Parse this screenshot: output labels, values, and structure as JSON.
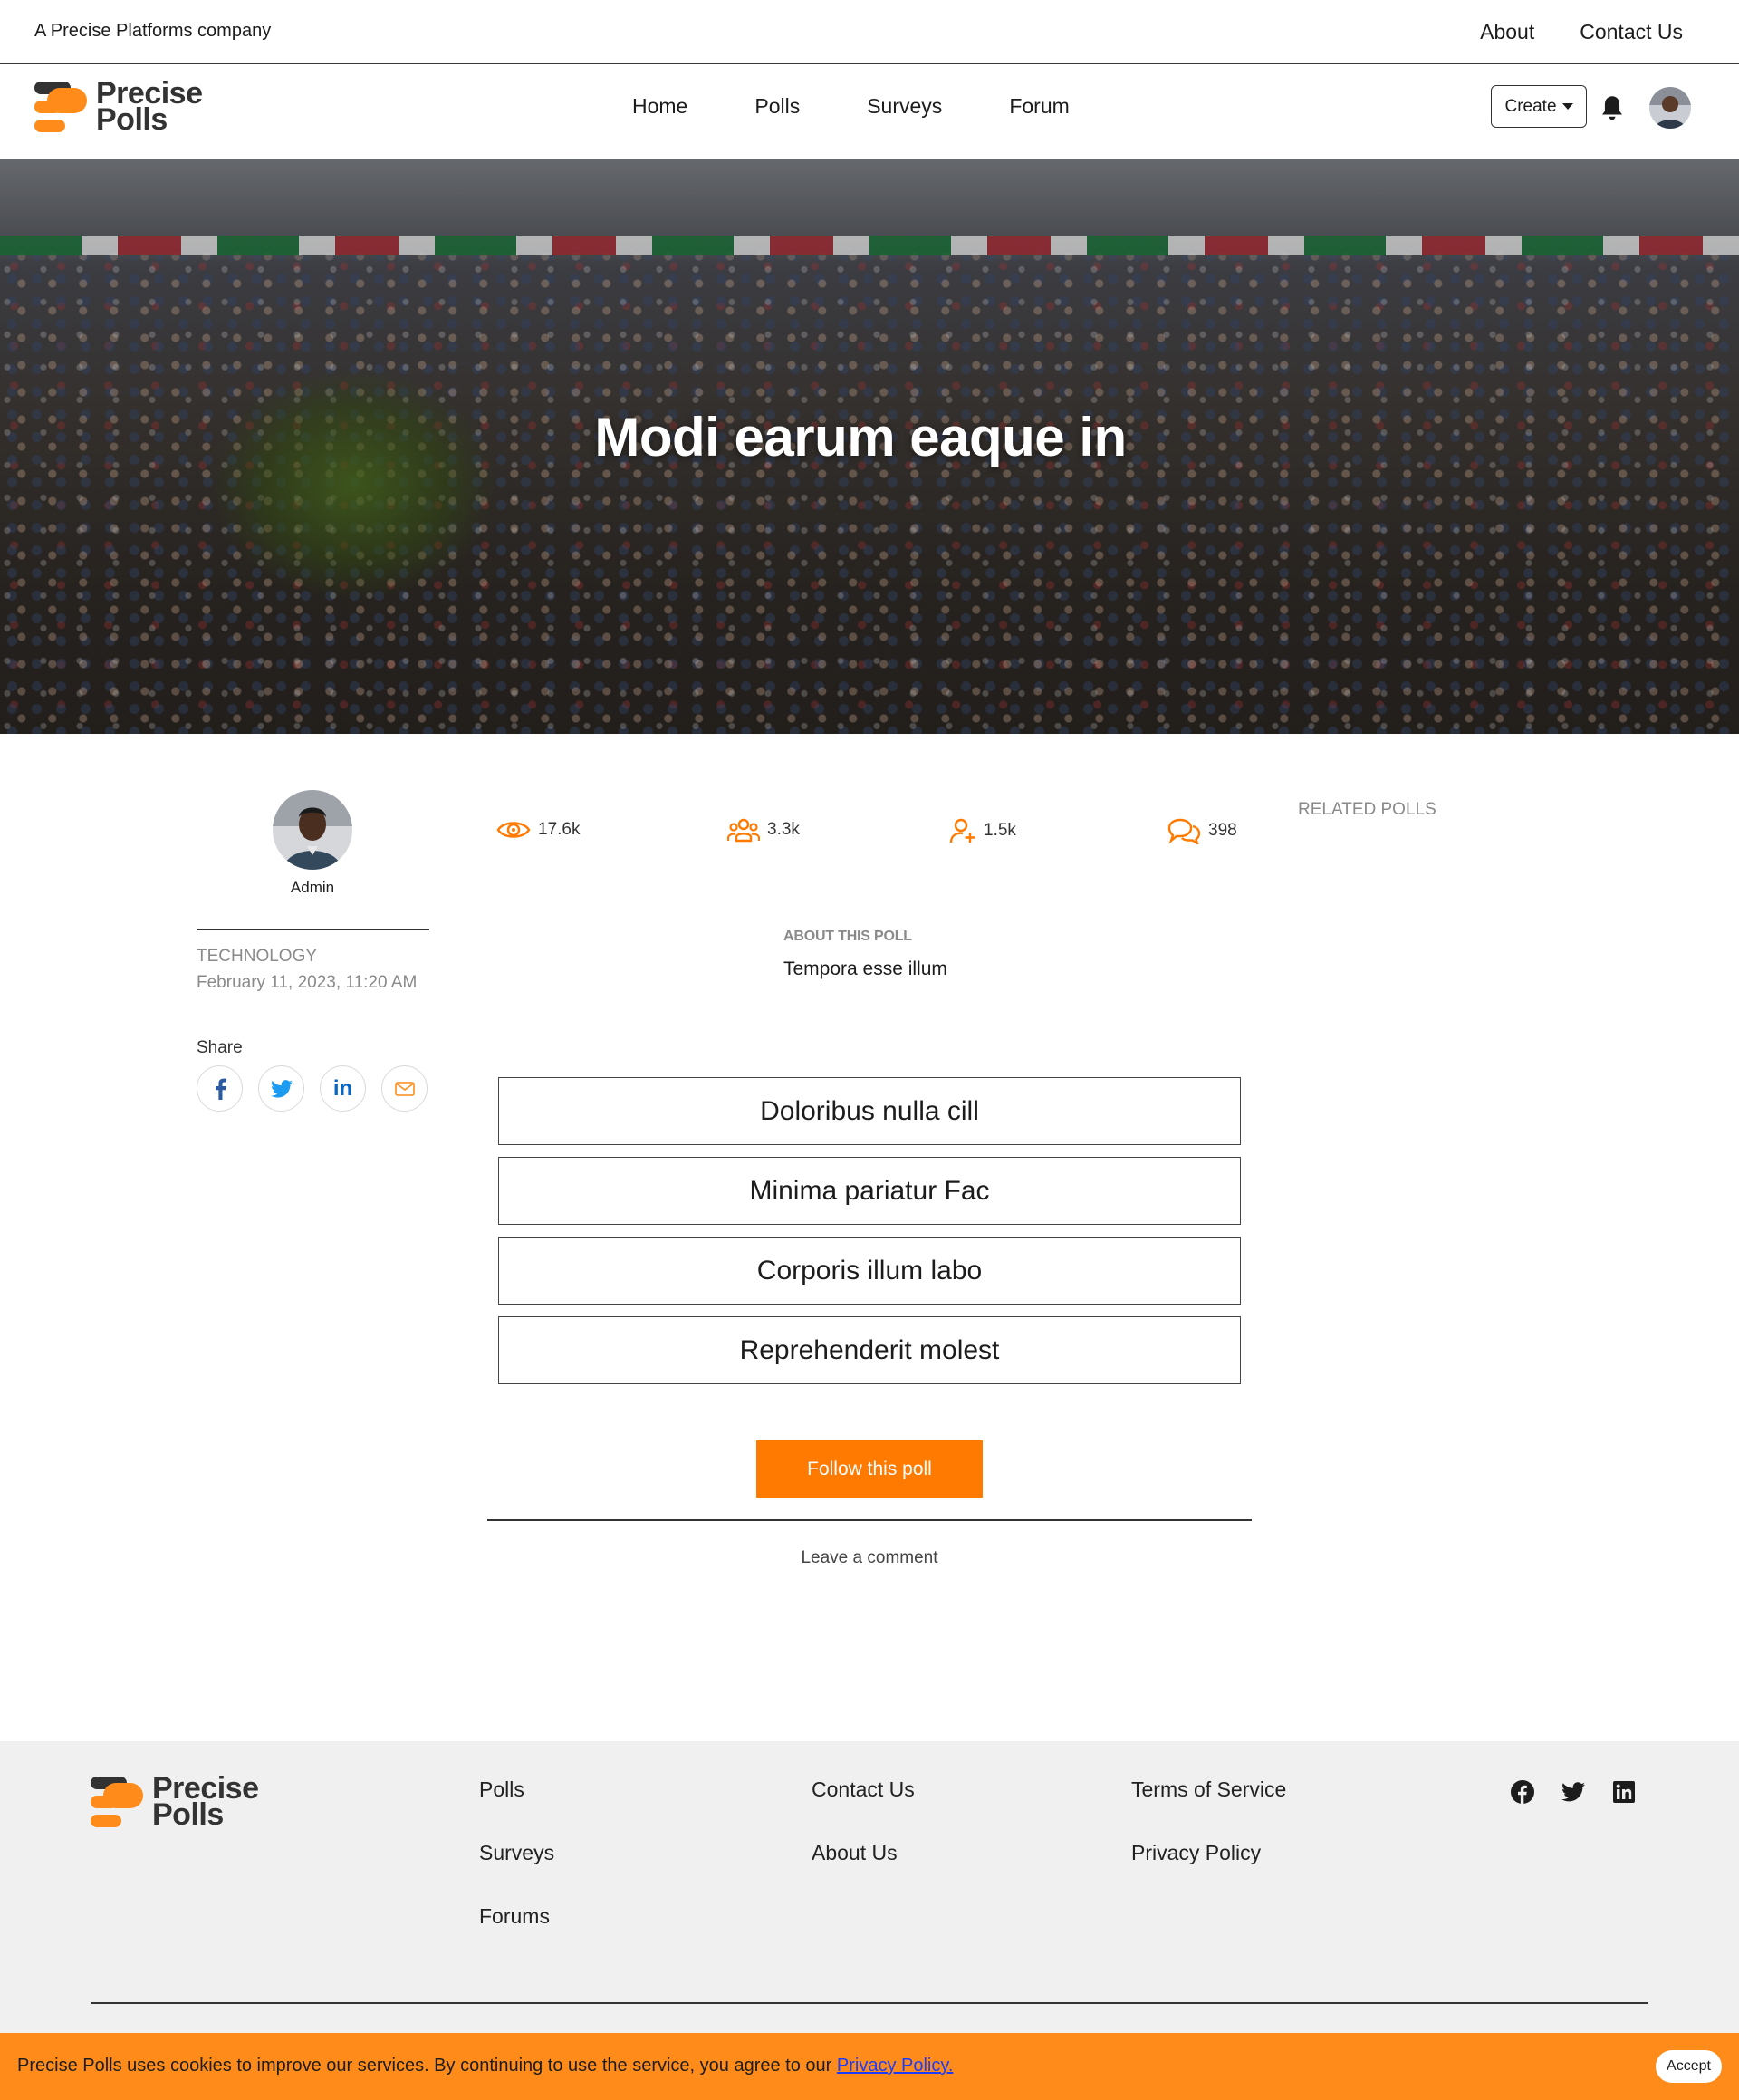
{
  "topbar": {
    "company": "A Precise Platforms company",
    "links": [
      "About",
      "Contact Us"
    ]
  },
  "brand": {
    "line1": "Precise",
    "line2": "Polls",
    "colors": {
      "accent": "#ff8c1a",
      "dark": "#333333"
    }
  },
  "nav": {
    "links": [
      "Home",
      "Polls",
      "Surveys",
      "Forum"
    ],
    "create_label": "Create",
    "bell_icon": "bell-icon",
    "avatar_icon": "user-avatar"
  },
  "hero": {
    "title": "Modi earum eaque in"
  },
  "author": {
    "name": "Admin"
  },
  "poll_meta": {
    "category": "TECHNOLOGY",
    "date": "February 11, 2023, 11:20 AM",
    "share_label": "Share",
    "share_icons": [
      "facebook-icon",
      "twitter-icon",
      "linkedin-icon",
      "mail-icon"
    ]
  },
  "stats": [
    {
      "icon": "eye-icon",
      "value": "17.6k"
    },
    {
      "icon": "users-icon",
      "value": "3.3k"
    },
    {
      "icon": "user-add-icon",
      "value": "1.5k"
    },
    {
      "icon": "comments-icon",
      "value": "398"
    }
  ],
  "about": {
    "label": "ABOUT THIS POLL",
    "text": "Tempora esse illum"
  },
  "options": [
    "Doloribus nulla cill",
    "Minima pariatur Fac",
    "Corporis illum labo",
    "Reprehenderit molest"
  ],
  "follow_label": "Follow this poll",
  "leave_comment": "Leave a comment",
  "related_label": "RELATED POLLS",
  "footer": {
    "col1": [
      "Polls",
      "Surveys",
      "Forums"
    ],
    "col2": [
      "Contact Us",
      "About Us"
    ],
    "col3": [
      "Terms of Service",
      "Privacy Policy"
    ],
    "social": [
      "facebook-icon",
      "twitter-icon",
      "linkedin-icon"
    ]
  },
  "cookie": {
    "message": "Precise Polls uses cookies to improve our services. By continuing to use the service, you agree to our ",
    "link": "Privacy Policy.",
    "accept": "Accept"
  }
}
